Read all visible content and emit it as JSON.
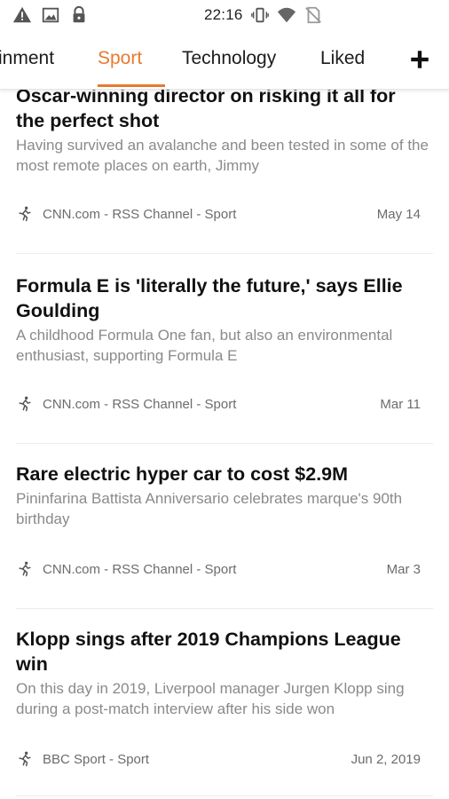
{
  "status_bar": {
    "time": "22:16",
    "icons": [
      "warning-icon",
      "image-icon",
      "lock-icon",
      "vibrate-icon",
      "wifi-icon",
      "no-sim-icon"
    ]
  },
  "tabs": {
    "items": [
      {
        "label": "inment"
      },
      {
        "label": "Sport"
      },
      {
        "label": "Technology"
      },
      {
        "label": "Liked"
      }
    ],
    "active_index": 1,
    "accent_color": "#e87a2f",
    "add_icon": "plus-icon"
  },
  "articles": [
    {
      "title": "Oscar-winning director on risking it all for the perfect shot",
      "summary": "Having survived an avalanche and been tested in some of the most remote places on earth, Jimmy",
      "source": "CNN.com - RSS Channel - Sport",
      "date": "May 14"
    },
    {
      "title": "Formula E is 'literally the future,' says Ellie Goulding",
      "summary": "A childhood Formula One fan, but also an environmental enthusiast, supporting Formula E",
      "source": "CNN.com - RSS Channel - Sport",
      "date": "Mar 11"
    },
    {
      "title": "Rare electric hyper car to cost $2.9M",
      "summary": "Pininfarina Battista Anniversario celebrates marque's 90th birthday",
      "source": "CNN.com - RSS Channel - Sport",
      "date": "Mar 3"
    },
    {
      "title": "Klopp sings after 2019 Champions League win",
      "summary": "On this day in 2019, Liverpool manager Jurgen Klopp sing during a post-match interview after his side won",
      "source": "BBC Sport - Sport",
      "date": "Jun 2, 2019"
    }
  ]
}
